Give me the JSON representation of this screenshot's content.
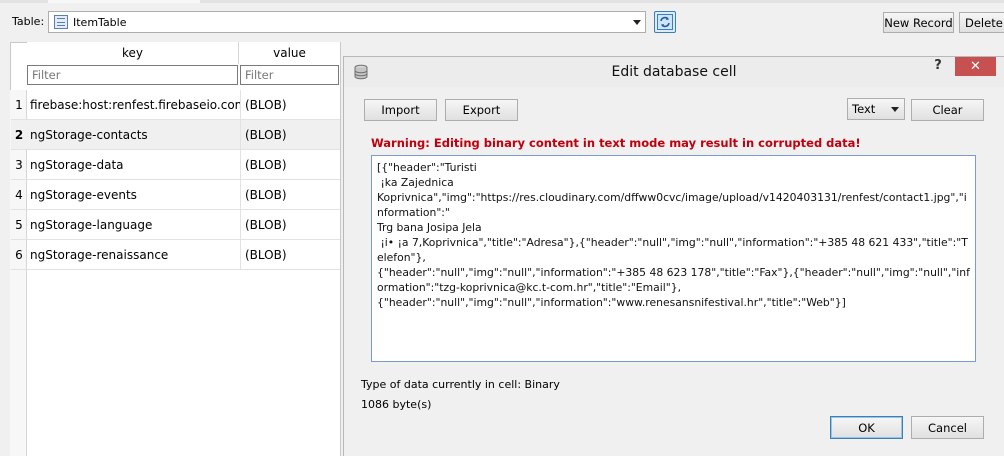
{
  "toolbar": {
    "table_label": "Table:",
    "table_value": "ItemTable",
    "new_record": "New Record",
    "delete_record": "Delete R"
  },
  "grid": {
    "columns": [
      "key",
      "value"
    ],
    "filter_placeholder": "Filter",
    "rows": [
      {
        "num": "1",
        "key": "firebase:host:renfest.firebaseio.com",
        "value": "(BLOB)"
      },
      {
        "num": "2",
        "key": "ngStorage-contacts",
        "value": "(BLOB)"
      },
      {
        "num": "3",
        "key": "ngStorage-data",
        "value": "(BLOB)"
      },
      {
        "num": "4",
        "key": "ngStorage-events",
        "value": "(BLOB)"
      },
      {
        "num": "5",
        "key": "ngStorage-language",
        "value": "(BLOB)"
      },
      {
        "num": "6",
        "key": "ngStorage-renaissance",
        "value": "(BLOB)"
      }
    ],
    "selected_row": 2
  },
  "dialog": {
    "title": "Edit database cell",
    "help": "?",
    "close": "✕",
    "import": "Import",
    "export": "Export",
    "mode": "Text",
    "clear": "Clear",
    "warning": "Warning: Editing binary content in text mode may result in corrupted data!",
    "content": "[{\"header\":\"Turisti\n ¡ka Zajednica\nKoprivnica\",\"img\":\"https://res.cloudinary.com/dffww0cvc/image/upload/v1420403131/renfest/contact1.jpg\",\"information\":\"\nTrg bana Josipa Jela\n ¡i• ¡a 7,Koprivnica\",\"title\":\"Adresa\"},{\"header\":\"null\",\"img\":\"null\",\"information\":\"+385 48 621 433\",\"title\":\"Telefon\"},\n{\"header\":\"null\",\"img\":\"null\",\"information\":\"+385 48 623 178\",\"title\":\"Fax\"},{\"header\":\"null\",\"img\":\"null\",\"information\":\"tzg-koprivnica@kc.t-com.hr\",\"title\":\"Email\"},\n{\"header\":\"null\",\"img\":\"null\",\"information\":\"www.renesansnifestival.hr\",\"title\":\"Web\"}]",
    "type_info": "Type of data currently in cell: Binary",
    "size_info": "1086 byte(s)",
    "ok": "OK",
    "cancel": "Cancel"
  },
  "colors": {
    "warning": "#c0000f",
    "close_button": "#c75050",
    "accent": "#3c7fb1"
  },
  "icons": {
    "table": "table-icon",
    "refresh": "refresh-icon",
    "dialog": "database-icon",
    "combo": "chevron-down-icon"
  }
}
